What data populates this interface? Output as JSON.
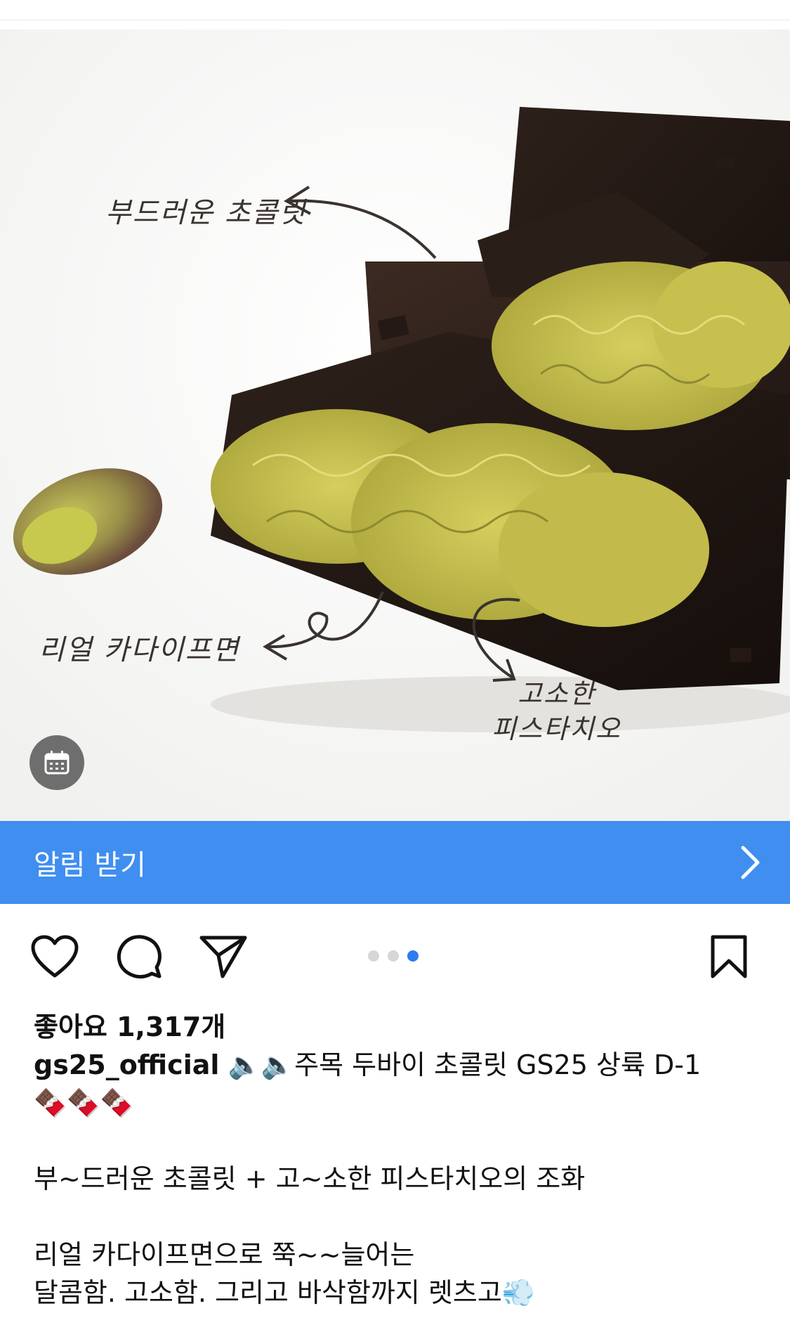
{
  "photo": {
    "annotations": {
      "smooth_chocolate": "부드러운 초콜릿",
      "kadaif": "리얼 카다이프면",
      "pistachio_line1": "고소한",
      "pistachio_line2": "피스타치오"
    },
    "calendar_icon": "calendar-icon"
  },
  "notify_bar": {
    "label": "알림 받기",
    "icon": "chevron-right-icon",
    "color": "#3f8ef0"
  },
  "actions": {
    "icons": [
      "heart-icon",
      "comment-icon",
      "send-icon",
      "bookmark-icon"
    ],
    "carousel": {
      "total": 3,
      "active": 3
    }
  },
  "post": {
    "likes": "좋아요 1,317개",
    "username": "gs25_official",
    "caption_first": "🔈🔈주목 두바이 초콜릿 GS25 상륙 D-1",
    "caption_emoji": "🍫🍫🍫",
    "caption_line2": "부~드러운 초콜릿 + 고~소한 피스타치오의 조화",
    "caption_line3": "리얼 카다이프면으로 쭉~~늘어는",
    "caption_line4": "달콤함. 고소함. 그리고 바삭함까지 렛츠고💨"
  }
}
